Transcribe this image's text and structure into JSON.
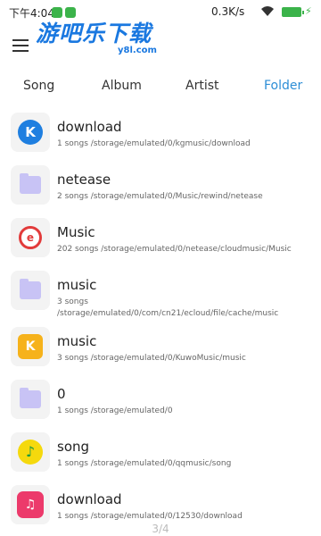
{
  "status_bar": {
    "time": "下午4:04",
    "net_speed": "0.3K/s",
    "colors": {
      "battery": "#3bb34a"
    }
  },
  "header": {
    "menu_icon": "hamburger-icon",
    "watermark_text": "游吧乐下载",
    "watermark_sub": "y8l.com"
  },
  "tabs": [
    {
      "label": "Song"
    },
    {
      "label": "Album"
    },
    {
      "label": "Artist"
    },
    {
      "label": "Folder",
      "active": true
    }
  ],
  "accent_color": "#2d8ed6",
  "folders": [
    {
      "title": "download",
      "subtitle": "1 songs /storage/emulated/0/kgmusic/download",
      "icon": "kugou-app-icon"
    },
    {
      "title": "netease",
      "subtitle": "2 songs /storage/emulated/0/Music/rewind/netease",
      "icon": "folder-icon"
    },
    {
      "title": "Music",
      "subtitle": "202 songs /storage/emulated/0/netease/cloudmusic/Music",
      "icon": "netease-app-icon"
    },
    {
      "title": "music",
      "subtitle": "3 songs /storage/emulated/0/com/cn21/ecloud/file/cache/music",
      "icon": "folder-icon"
    },
    {
      "title": "music",
      "subtitle": "3 songs /storage/emulated/0/KuwoMusic/music",
      "icon": "kuwo-app-icon"
    },
    {
      "title": "0",
      "subtitle": "1 songs /storage/emulated/0",
      "icon": "folder-icon"
    },
    {
      "title": "song",
      "subtitle": "1 songs /storage/emulated/0/qqmusic/song",
      "icon": "qqmusic-app-icon"
    },
    {
      "title": "download",
      "subtitle": "1 songs /storage/emulated/0/12530/download",
      "icon": "migu-app-icon"
    }
  ],
  "pager": "3/4"
}
